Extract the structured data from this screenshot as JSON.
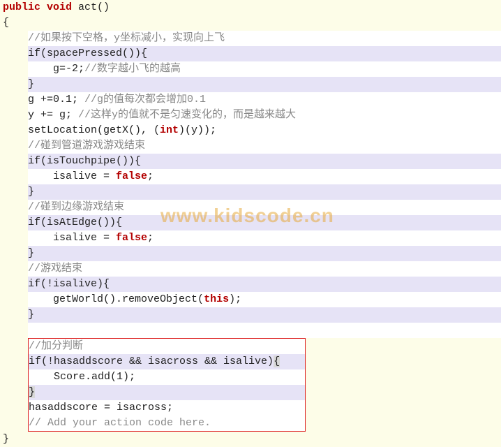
{
  "code": {
    "l1_public": "public",
    "l1_void": "void",
    "l1_rest": " act()",
    "l2": "{",
    "c1": "//如果按下空格，y坐标减小，实现向上飞",
    "if1": "if(spacePressed()){",
    "g_assign": "g=-2;",
    "g_comment": "//数字越小飞的越高",
    "close1": "}",
    "gplus": "g +=0.1; ",
    "gplus_c": "//g的值每次都会增加0.1",
    "yplus": "y += g; ",
    "yplus_c": "//这样y的值就不是匀速变化的，而是越来越大",
    "setloc_a": "setLocation(getX(), (",
    "setloc_int": "int",
    "setloc_b": ")(y));",
    "c_pipe": "//碰到管道游戏游戏结束",
    "if2": "if(isTouchpipe()){",
    "alive_eq": "isalive = ",
    "false": "false",
    "semi": ";",
    "close2": "}",
    "c_edge": "//碰到边缘游戏结束",
    "if3": "if(isAtEdge()){",
    "close3": "}",
    "c_over": "//游戏结束",
    "if4": "if(!isalive){",
    "remove_a": "getWorld().removeObject(",
    "this": "this",
    "remove_b": ");",
    "close4": "}",
    "c_score": "//加分判断",
    "if5_a": "if(!hasaddscore && isacross && isalive)",
    "if5_b": "{",
    "score_add": "Score.add(1);",
    "close5": "}",
    "has": "hasaddscore = isacross;",
    "add_c": "// Add your action code here.",
    "end": "}"
  },
  "watermark": "www.kidscode.cn"
}
